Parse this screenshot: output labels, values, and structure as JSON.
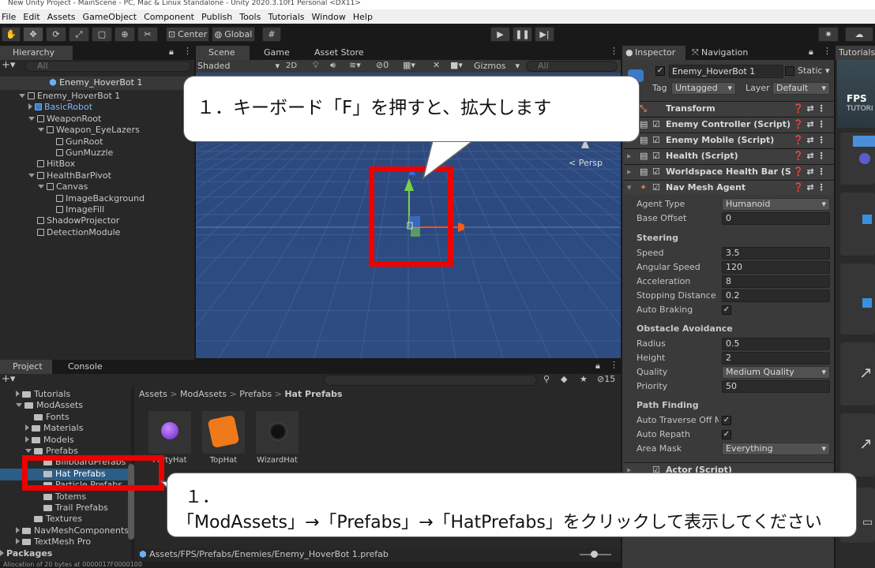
{
  "window": {
    "title": "New Unity Project - MainScene - PC, Mac & Linux Standalone - Unity 2020.3.10f1 Personal <DX11>"
  },
  "menu": [
    "File",
    "Edit",
    "Assets",
    "GameObject",
    "Component",
    "Publish",
    "Tools",
    "Tutorials",
    "Window",
    "Help"
  ],
  "toolbar": {
    "center": "Center",
    "global": "Global"
  },
  "hierarchy": {
    "tab": "Hierarchy",
    "search_placeholder": "All",
    "scene": "Enemy_HoverBot 1",
    "items": [
      {
        "label": "Enemy_HoverBot 1",
        "depth": 0,
        "expand": "down"
      },
      {
        "label": "BasicRobot",
        "depth": 1,
        "expand": "right",
        "prefab": true
      },
      {
        "label": "WeaponRoot",
        "depth": 1,
        "expand": "down"
      },
      {
        "label": "Weapon_EyeLazers",
        "depth": 2,
        "expand": "down"
      },
      {
        "label": "GunRoot",
        "depth": 3,
        "expand": ""
      },
      {
        "label": "GunMuzzle",
        "depth": 3,
        "expand": ""
      },
      {
        "label": "HitBox",
        "depth": 1,
        "expand": ""
      },
      {
        "label": "HealthBarPivot",
        "depth": 1,
        "expand": "down"
      },
      {
        "label": "Canvas",
        "depth": 2,
        "expand": "down"
      },
      {
        "label": "ImageBackground",
        "depth": 3,
        "expand": ""
      },
      {
        "label": "ImageFill",
        "depth": 3,
        "expand": ""
      },
      {
        "label": "ShadowProjector",
        "depth": 1,
        "expand": ""
      },
      {
        "label": "DetectionModule",
        "depth": 1,
        "expand": ""
      }
    ]
  },
  "scene": {
    "tabs": [
      "Scene",
      "Game",
      "Asset Store"
    ],
    "shading": "Shaded",
    "mode2d": "2D",
    "fx_count": "0",
    "gizmos": "Gizmos",
    "search_placeholder": "All",
    "persp": "< Persp"
  },
  "inspector": {
    "tabs": [
      "Inspector",
      "Navigation"
    ],
    "name": "Enemy_HoverBot 1",
    "static": "Static",
    "tag_label": "Tag",
    "tag": "Untagged",
    "layer_label": "Layer",
    "layer": "Default",
    "components": [
      "Transform",
      "Enemy Controller (Script)",
      "Enemy Mobile (Script)",
      "Health (Script)",
      "Worldspace Health Bar (Script)",
      "Nav Mesh Agent"
    ],
    "agent_type_label": "Agent Type",
    "agent_type": "Humanoid",
    "base_offset_label": "Base Offset",
    "base_offset": "0",
    "steering": "Steering",
    "speed_label": "Speed",
    "speed": "3.5",
    "angular_label": "Angular Speed",
    "angular": "120",
    "accel_label": "Acceleration",
    "accel": "8",
    "stop_label": "Stopping Distance",
    "stop": "0.2",
    "braking_label": "Auto Braking",
    "obstacle": "Obstacle Avoidance",
    "radius_label": "Radius",
    "radius": "0.5",
    "height_label": "Height",
    "height": "2",
    "quality_label": "Quality",
    "quality": "Medium Quality",
    "priority_label": "Priority",
    "priority": "50",
    "pathfinding": "Path Finding",
    "traverse_label": "Auto Traverse Off Me",
    "repath_label": "Auto Repath",
    "area_label": "Area Mask",
    "area": "Everything",
    "actor": "Actor (Script)"
  },
  "tutorials": {
    "tab": "Tutorials",
    "fps": "FPS",
    "sub": "TUTORI"
  },
  "project": {
    "tabs": [
      "Project",
      "Console"
    ],
    "search_placeholder": "",
    "hidden_count": "15",
    "breadcrumb": [
      "Assets",
      "ModAssets",
      "Prefabs",
      "Hat Prefabs"
    ],
    "tree": [
      {
        "label": "Tutorials",
        "depth": 1,
        "expand": "right"
      },
      {
        "label": "ModAssets",
        "depth": 1,
        "expand": "down"
      },
      {
        "label": "Fonts",
        "depth": 2,
        "expand": ""
      },
      {
        "label": "Materials",
        "depth": 2,
        "expand": "right"
      },
      {
        "label": "Models",
        "depth": 2,
        "expand": "right"
      },
      {
        "label": "Prefabs",
        "depth": 2,
        "expand": "down"
      },
      {
        "label": "BillboardPrefabs",
        "depth": 3,
        "expand": ""
      },
      {
        "label": "Hat Prefabs",
        "depth": 3,
        "expand": "",
        "selected": true
      },
      {
        "label": "Particle Prefabs",
        "depth": 3,
        "expand": ""
      },
      {
        "label": "Totems",
        "depth": 3,
        "expand": ""
      },
      {
        "label": "Trail Prefabs",
        "depth": 3,
        "expand": ""
      },
      {
        "label": "Textures",
        "depth": 2,
        "expand": ""
      },
      {
        "label": "NavMeshComponents",
        "depth": 1,
        "expand": "right"
      },
      {
        "label": "TextMesh Pro",
        "depth": 1,
        "expand": "right"
      },
      {
        "label": "Packages",
        "depth": 0,
        "expand": "right"
      }
    ],
    "assets": [
      "PartyHat",
      "TopHat",
      "WizardHat"
    ],
    "path": "Assets/FPS/Prefabs/Enemies/Enemy_HoverBot 1.prefab"
  },
  "status": "Allocation of 20 bytes at 0000017F0000100",
  "annotations": {
    "callout1": "１．キーボード「F」を押すと、拡大します",
    "callout2_num": "１．",
    "callout2": "「ModAssets」→「Prefabs」→「HatPrefabs」をクリックして表示してください"
  },
  "colors": {
    "accent": "#3a72b0",
    "red": "#ee0000",
    "sky": "#2e4b7c"
  }
}
